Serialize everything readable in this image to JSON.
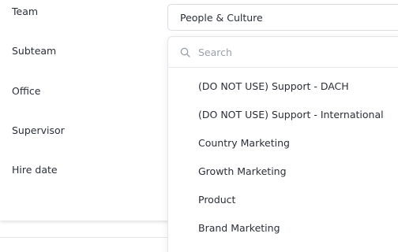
{
  "form": {
    "fields": [
      {
        "label": "Team"
      },
      {
        "label": "Subteam"
      },
      {
        "label": "Office"
      },
      {
        "label": "Supervisor"
      },
      {
        "label": "Hire date"
      }
    ]
  },
  "team_select": {
    "value": "People & Culture"
  },
  "subteam_dropdown": {
    "search_placeholder": "Search",
    "search_icon": "search-icon",
    "options": [
      {
        "label": "(DO NOT USE) Support - DACH"
      },
      {
        "label": "(DO NOT USE) Support - International"
      },
      {
        "label": "Country Marketing"
      },
      {
        "label": "Growth Marketing"
      },
      {
        "label": "Product"
      },
      {
        "label": "Brand Marketing"
      }
    ]
  },
  "colors": {
    "text": "#2b2f36",
    "placeholder": "#9aa0a8",
    "border": "#d9dce1"
  }
}
